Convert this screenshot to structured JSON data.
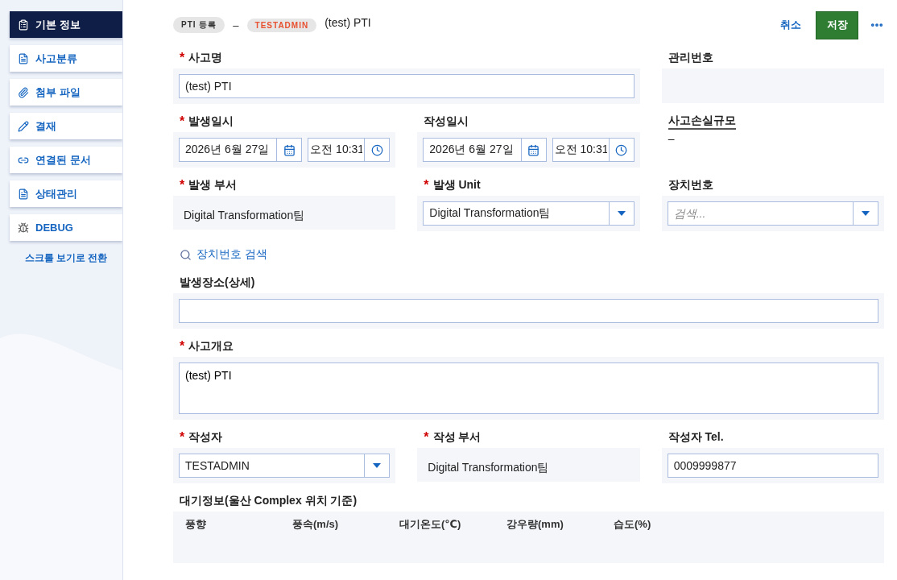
{
  "sidebar": {
    "items": [
      {
        "label": "기본 정보",
        "selected": true
      },
      {
        "label": "사고분류",
        "selected": false
      },
      {
        "label": "첨부 파일",
        "selected": false
      },
      {
        "label": "결재",
        "selected": false
      },
      {
        "label": "연결된 문서",
        "selected": false
      },
      {
        "label": "상태관리",
        "selected": false
      },
      {
        "label": "DEBUG",
        "selected": false
      }
    ],
    "toggle_link": "스크롤 보기로 전환"
  },
  "header": {
    "badge": "PTI 등록",
    "separator": "–",
    "user_badge": "TESTADMIN",
    "title": "(test) PTI",
    "cancel": "취소",
    "save": "저장"
  },
  "fields": [
    {
      "kind": "input",
      "label": "사고명",
      "required_mark": "*",
      "value": "(test) PTI"
    },
    {
      "kind": "readonly",
      "label": "관리번호"
    },
    {
      "kind": "datetime",
      "label": "발생일시",
      "required_mark": "*",
      "date": "2026년 6월 27일",
      "time": "오전 10:31"
    },
    {
      "kind": "datetime",
      "label": "작성일시",
      "date": "2026년 6월 27일",
      "time": "오전 10:31"
    },
    {
      "kind": "summary",
      "label": "사고손실규모",
      "value": "–"
    },
    {
      "kind": "static",
      "label": "발생 부서",
      "required_mark": "*",
      "value": "Digital Transformation팀"
    },
    {
      "kind": "select",
      "label": "발생 Unit",
      "required_mark": "*",
      "value": "Digital Transformation팀"
    },
    {
      "kind": "select",
      "label": "장치번호",
      "placeholder": "검색..."
    },
    {
      "kind": "action",
      "label": "장치번호 검색"
    },
    {
      "kind": "input",
      "label": "발생장소(상세)"
    },
    {
      "kind": "textarea",
      "label": "사고개요",
      "required_mark": "*",
      "value": "(test) PTI"
    },
    {
      "kind": "select",
      "label": "작성자",
      "required_mark": "*",
      "value": "TESTADMIN"
    },
    {
      "kind": "static",
      "label": "작성 부서",
      "required_mark": "*",
      "value": "Digital Transformation팀"
    },
    {
      "kind": "input",
      "label": "작성자 Tel.",
      "value": "0009999877"
    },
    {
      "kind": "table",
      "label": "대기정보(울산 Complex 위치 기준)",
      "columns": [
        "풍향",
        "풍속(m/s)",
        "대기온도(℃)",
        "강우량(mm)",
        "습도(%)"
      ]
    }
  ]
}
